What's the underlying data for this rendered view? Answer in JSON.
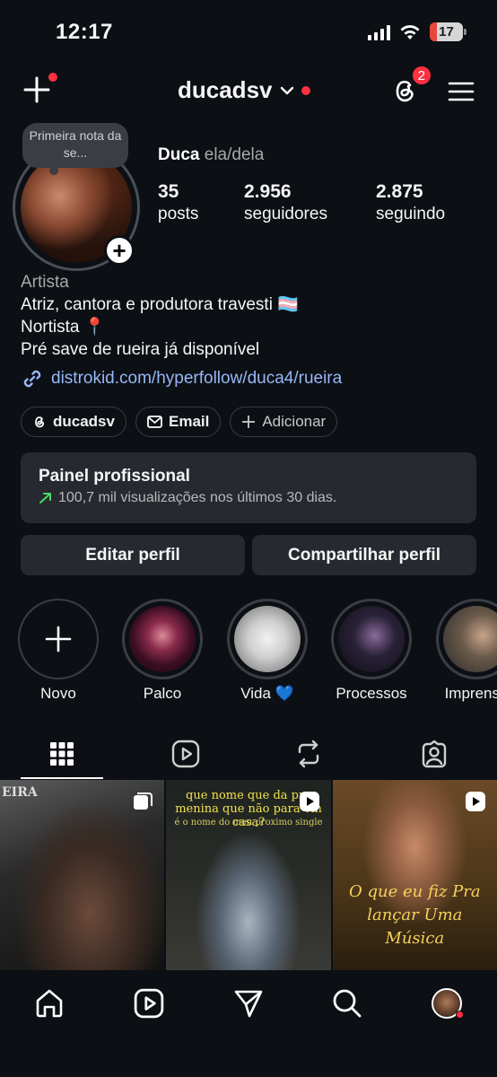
{
  "status_bar": {
    "time": "12:17",
    "battery": "17"
  },
  "header": {
    "username": "ducadsv",
    "threads_badge": "2"
  },
  "profile": {
    "note": "Primeira nota da se...",
    "name": "Duca",
    "pronouns": "ela/dela",
    "stats": [
      {
        "value": "35",
        "label": "posts"
      },
      {
        "value": "2.956",
        "label": "seguidores"
      },
      {
        "value": "2.875",
        "label": "seguindo"
      }
    ],
    "category": "Artista",
    "bio_lines": [
      "Atriz, cantora e produtora travesti 🏳️‍⚧️",
      "Nortista 📍",
      "Pré save de rueira já disponível"
    ],
    "link": "distrokid.com/hyperfollow/duca4/rueira"
  },
  "chips": {
    "threads": "ducadsv",
    "email": "Email",
    "add": "Adicionar"
  },
  "panel": {
    "title": "Painel profissional",
    "subtitle": "100,7 mil visualizações nos últimos 30 dias."
  },
  "actions": {
    "edit": "Editar perfil",
    "share": "Compartilhar perfil"
  },
  "highlights": [
    {
      "label": "Novo"
    },
    {
      "label": "Palco"
    },
    {
      "label": "Vida 💙"
    },
    {
      "label": "Processos"
    },
    {
      "label": "Imprensa"
    }
  ],
  "grid": {
    "post1_text": "EIRA",
    "post2_title": "que nome que da pra menina que não para em casa?",
    "post2_sub": "é o nome do meu proximo single",
    "post3_text": "O que eu fiz Pra lançar Uma Música"
  },
  "icons": {
    "create": "plus-icon",
    "dropdown": "chevron-down-icon",
    "threads": "threads-icon",
    "menu": "hamburger-menu-icon",
    "link": "link-icon",
    "mail": "mail-icon",
    "trend": "trend-up-icon",
    "grid_tab": "grid-icon",
    "reels_tab": "reels-icon",
    "reposts_tab": "repost-icon",
    "tagged_tab": "tagged-icon",
    "home": "home-icon",
    "search": "search-icon",
    "send": "send-icon"
  },
  "colors": {
    "background": "#0c0f14",
    "accent_red": "#ff3040",
    "link_blue": "#97b7f7",
    "card": "#262a30"
  }
}
